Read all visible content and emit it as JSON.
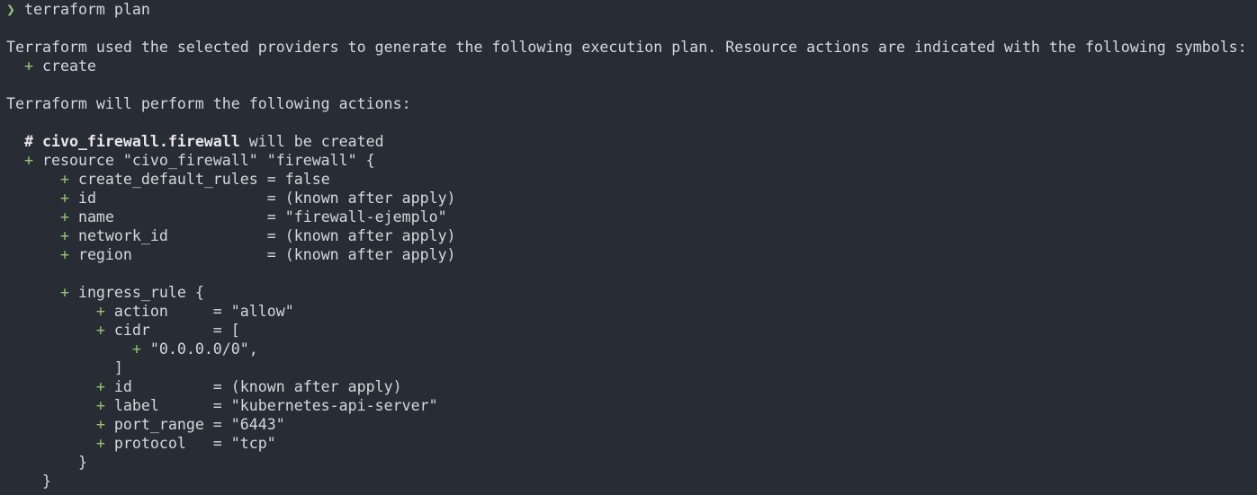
{
  "terminal": {
    "colors": {
      "background": "#282c34",
      "foreground": "#d3d7de",
      "prompt": "#98c379",
      "plus": "#98c379"
    },
    "prompt_symbol": "❯",
    "command": "terraform plan",
    "lines": {
      "intro": "Terraform used the selected providers to generate the following execution plan. Resource actions are indicated with the following symbols:",
      "symbol_create": "create",
      "will_perform": "Terraform will perform the following actions:",
      "comment_hash": "#",
      "comment_resource": "civo_firewall.firewall",
      "comment_rest": "will be created",
      "resource_decl": "resource \"civo_firewall\" \"firewall\" {",
      "attr_create_default_rules": "create_default_rules = false",
      "attr_id": "id                   = (known after apply)",
      "attr_name": "name                 = \"firewall-ejemplo\"",
      "attr_network_id": "network_id           = (known after apply)",
      "attr_region": "region               = (known after apply)",
      "ingress_open": "ingress_rule {",
      "ing_action": "action     = \"allow\"",
      "ing_cidr_open": "cidr       = [",
      "ing_cidr_value": "\"0.0.0.0/0\",",
      "ing_cidr_close": "]",
      "ing_id": "id         = (known after apply)",
      "ing_label": "label      = \"kubernetes-api-server\"",
      "ing_port_range": "port_range = \"6443\"",
      "ing_protocol": "protocol   = \"tcp\"",
      "ingress_close": "}",
      "resource_close": "}"
    },
    "plus_symbol": "+"
  }
}
